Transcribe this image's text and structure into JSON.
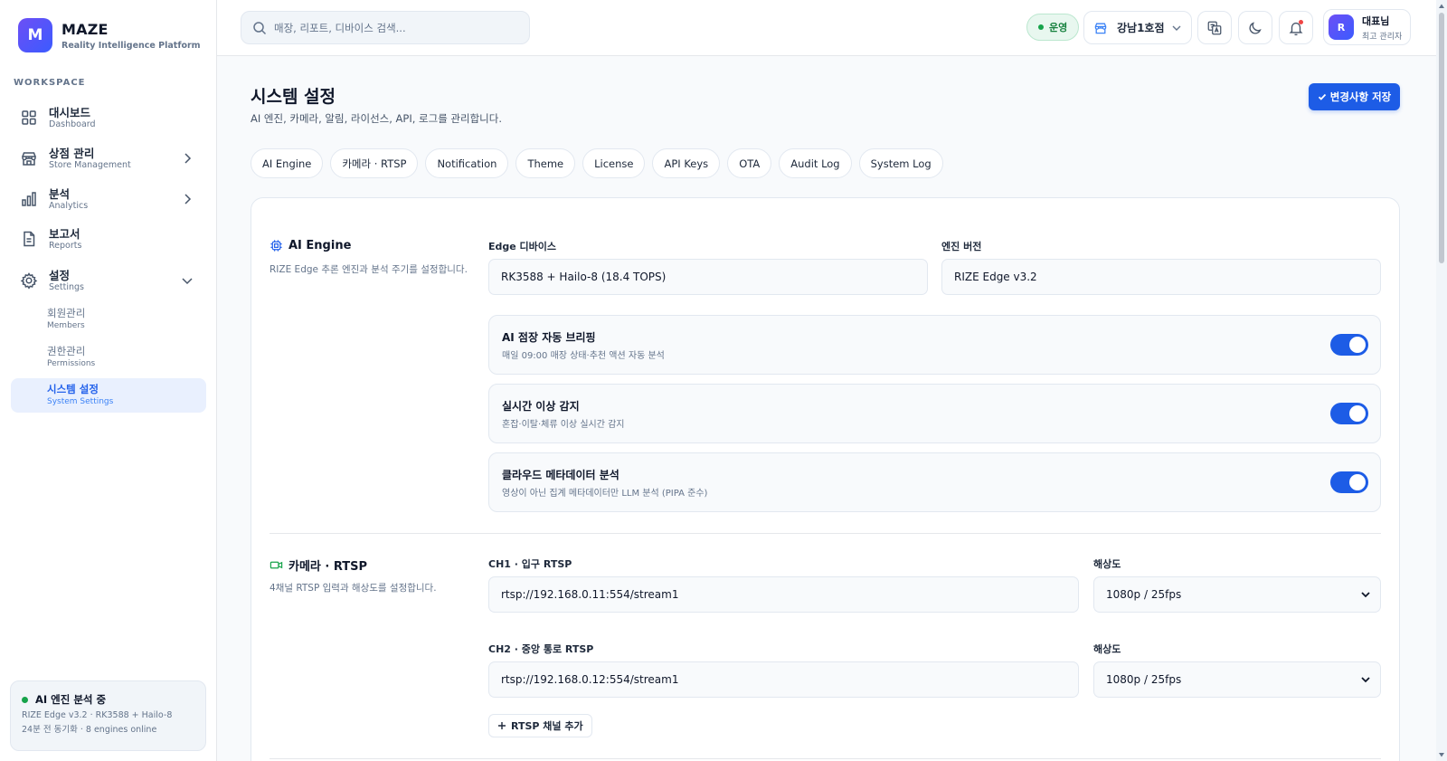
{
  "brand": {
    "logo_letter": "M",
    "name": "MAZE",
    "subtitle": "Reality Intelligence Platform"
  },
  "sidebar": {
    "section_label": "WORKSPACE",
    "items": [
      {
        "ko": "대시보드",
        "en": "Dashboard",
        "icon": "grid-icon"
      },
      {
        "ko": "상점 관리",
        "en": "Store Management",
        "icon": "store-icon"
      },
      {
        "ko": "분석",
        "en": "Analytics",
        "icon": "bar-chart-icon"
      },
      {
        "ko": "보고서",
        "en": "Reports",
        "icon": "document-icon"
      },
      {
        "ko": "설정",
        "en": "Settings",
        "icon": "gear-icon"
      }
    ],
    "sub_items": [
      {
        "ko": "회원관리",
        "en": "Members"
      },
      {
        "ko": "권한관리",
        "en": "Permissions"
      },
      {
        "ko": "시스템 설정",
        "en": "System Settings",
        "active": true
      }
    ],
    "engine_card": {
      "title": "AI 엔진 분석 중",
      "line1": "RIZE Edge v3.2 · RK3588 + Hailo-8",
      "line2": "24분 전 동기화 · 8 engines online"
    }
  },
  "header": {
    "search_placeholder": "매장, 리포트, 디바이스 검색...",
    "status": "운영",
    "store": "강남1호점",
    "user_initial": "R",
    "user_name": "대표님",
    "user_role": "최고 관리자"
  },
  "page": {
    "title": "시스템 설정",
    "description": "AI 엔진, 카메라, 알림, 라이선스, API, 로그를 관리합니다.",
    "save_label": "변경사항 저장",
    "tabs": [
      "AI Engine",
      "카메라 · RTSP",
      "Notification",
      "Theme",
      "License",
      "API Keys",
      "OTA",
      "Audit Log",
      "System Log"
    ]
  },
  "ai_engine": {
    "title": "AI Engine",
    "description": "RIZE Edge 추론 엔진과 분석 주기를 설정합니다.",
    "edge_label": "Edge 디바이스",
    "edge_value": "RK3588 + Hailo-8 (18.4 TOPS)",
    "version_label": "엔진 버전",
    "version_value": "RIZE Edge v3.2",
    "toggles": [
      {
        "title": "AI 점장 자동 브리핑",
        "sub": "매일 09:00 매장 상태·추천 액션 자동 분석",
        "on": true
      },
      {
        "title": "실시간 이상 감지",
        "sub": "혼잡·이탈·체류 이상 실시간 감지",
        "on": true
      },
      {
        "title": "클라우드 메타데이터 분석",
        "sub": "영상이 아닌 집계 메타데이터만 LLM 분석 (PIPA 준수)",
        "on": true
      }
    ]
  },
  "camera": {
    "title": "카메라 · RTSP",
    "description": "4채널 RTSP 입력과 해상도를 설정합니다.",
    "channels": [
      {
        "label": "CH1 · 입구 RTSP",
        "url": "rtsp://192.168.0.11:554/stream1",
        "res_label": "해상도",
        "res": "1080p / 25fps"
      },
      {
        "label": "CH2 · 중앙 통로 RTSP",
        "url": "rtsp://192.168.0.12:554/stream1",
        "res_label": "해상도",
        "res": "1080p / 25fps"
      }
    ],
    "add_label": "RTSP 채널 추가"
  },
  "colors": {
    "accent": "#1d5ce6",
    "success": "#16a34a",
    "brand_gradient_start": "#6d4ff5"
  }
}
